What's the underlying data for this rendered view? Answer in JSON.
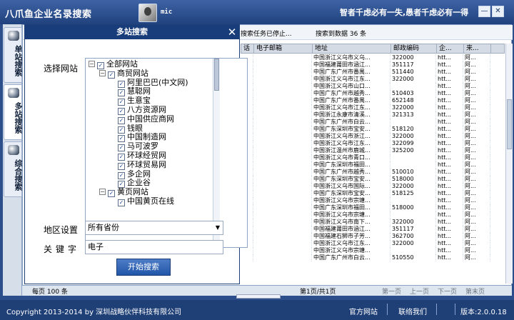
{
  "app": {
    "title": "八爪鱼企业名录搜索",
    "username": "mic",
    "slogan": "智者千虑必有一失,愚者千虑必有一得",
    "minimize_label": "—",
    "close_label": "✕"
  },
  "sidebar": {
    "tabs": [
      {
        "label": "单站搜索",
        "icon": "globe-icon"
      },
      {
        "label": "多站搜索",
        "icon": "books-icon"
      },
      {
        "label": "综合搜索",
        "icon": "stack-icon"
      }
    ]
  },
  "status": {
    "text": "搜索任务已停止...",
    "count": "搜索到数据 36 条"
  },
  "table": {
    "headers": [
      "话",
      "电子邮箱",
      "地址",
      "邮政编码",
      "企...",
      "来..."
    ],
    "rows": [
      [
        "",
        "",
        "中国浙江义乌市义乌...",
        "322000",
        "htt...",
        "阿..."
      ],
      [
        "",
        "",
        "中国福建莆田市涵江...",
        "351117",
        "htt...",
        "阿..."
      ],
      [
        "",
        "",
        "中国广东广州市番禺...",
        "511440",
        "htt...",
        "阿..."
      ],
      [
        "",
        "",
        "中国浙江义乌市江东...",
        "322000",
        "htt...",
        "阿..."
      ],
      [
        "",
        "",
        "中国浙江义乌市山口...",
        "",
        "htt...",
        "阿..."
      ],
      [
        "",
        "",
        "中国广东广州市越秀...",
        "510403",
        "htt...",
        "阿..."
      ],
      [
        "",
        "",
        "中国广东广州市番禺...",
        "652148",
        "htt...",
        "阿..."
      ],
      [
        "",
        "",
        "中国浙江义乌市江东...",
        "322000",
        "htt...",
        "阿..."
      ],
      [
        "",
        "",
        "中国浙江永康市清溪...",
        "321313",
        "htt...",
        "阿..."
      ],
      [
        "",
        "",
        "中国广东广州市白云...",
        "",
        "htt...",
        "阿..."
      ],
      [
        "",
        "",
        "中国广东深圳市宝安...",
        "518120",
        "htt...",
        "阿..."
      ],
      [
        "",
        "",
        "中国浙江义乌市浙江...",
        "322000",
        "htt...",
        "阿..."
      ],
      [
        "",
        "",
        "中国浙江义乌市江东...",
        "322099",
        "htt...",
        "阿..."
      ],
      [
        "",
        "",
        "中国浙江温州市鹿城...",
        "325200",
        "htt...",
        "阿..."
      ],
      [
        "",
        "",
        "中国浙江义乌市青口...",
        "",
        "htt...",
        "阿..."
      ],
      [
        "",
        "",
        "中国广东深圳市福田...",
        "",
        "htt...",
        "阿..."
      ],
      [
        "",
        "",
        "中国广东广州市越秀...",
        "510010",
        "htt...",
        "阿..."
      ],
      [
        "",
        "",
        "中国广东深圳市宝安...",
        "518000",
        "htt...",
        "阿..."
      ],
      [
        "",
        "",
        "中国浙江义乌市国际...",
        "322000",
        "htt...",
        "阿..."
      ],
      [
        "",
        "",
        "中国广东深圳市宝安...",
        "518125",
        "htt...",
        "阿..."
      ],
      [
        "",
        "",
        "中国浙江义乌市宗塘...",
        "",
        "htt...",
        "阿..."
      ],
      [
        "",
        "",
        "中国广东深圳市福田...",
        "518000",
        "htt...",
        "阿..."
      ],
      [
        "",
        "",
        "中国浙江义乌市宗塘...",
        "",
        "htt...",
        "阿..."
      ],
      [
        "",
        "",
        "中国浙江义乌市南下...",
        "322000",
        "htt...",
        "阿..."
      ],
      [
        "",
        "",
        "中国福建莆田市涵江...",
        "351117",
        "htt...",
        "阿..."
      ],
      [
        "",
        "",
        "中国福建石狮市子芳...",
        "362700",
        "htt...",
        "阿..."
      ],
      [
        "",
        "",
        "中国浙江义乌市江东...",
        "322000",
        "htt...",
        "阿..."
      ],
      [
        "",
        "",
        "中国浙江义乌市宗塘...",
        "",
        "htt...",
        "阿..."
      ],
      [
        "",
        "",
        "中国广东广州市白云...",
        "510550",
        "htt...",
        "阿..."
      ]
    ]
  },
  "panel": {
    "title": "多站搜索",
    "close_label": "✕",
    "site_label": "选择网站",
    "tree": {
      "root": "全部网站",
      "groups": [
        {
          "name": "商贸网站",
          "items": [
            "阿里巴巴(中文网)",
            "慧聪网",
            "生意宝",
            "八方资源网",
            "中国供应商网",
            "钱眼",
            "中国制造网",
            "马可波罗",
            "环球经贸网",
            "环球贸易网",
            "多企网",
            "企业谷"
          ]
        },
        {
          "name": "黄页网站",
          "items": [
            "中国黄页在线"
          ]
        }
      ]
    },
    "region_label": "地区设置",
    "region_value": "所有省份",
    "keyword_label": "关键字",
    "keyword_value": "电子",
    "start_label": "开始搜索"
  },
  "footer": {
    "page_size": "每页 100 条",
    "page_info": "第1页/共1页",
    "first": "第一页",
    "prev": "上一页",
    "next": "下一页",
    "last": "第末页"
  },
  "bottom": {
    "copyright": "Copyright 2013-2014 by 深圳战略伙伴科技有限公司",
    "official_site": "官方网站",
    "contact_us": "联络我们",
    "version": "版本:2.0.0.18"
  },
  "colors": {
    "title_bar": "#2a4c89",
    "panel_title": "#193c7a",
    "button": "#2f63b3"
  }
}
